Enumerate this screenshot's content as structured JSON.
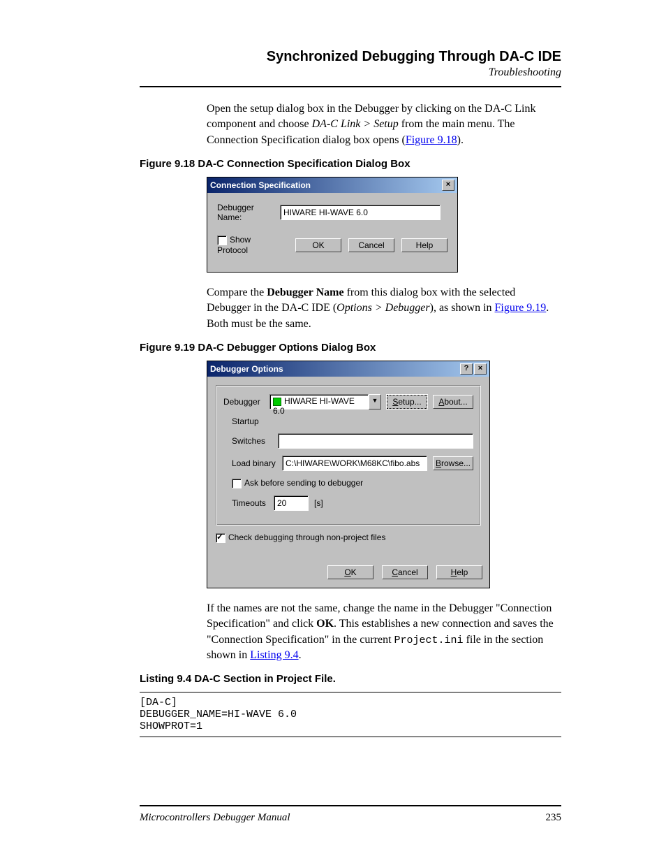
{
  "header": {
    "title": "Synchronized Debugging Through DA-C IDE",
    "sub": "Troubleshooting"
  },
  "p1": {
    "a": "Open the setup dialog box in the Debugger by clicking on the DA-C Link component and choose ",
    "b": "DA-C Link > Setup",
    "c": " from the main menu. The Connection Specification dialog box opens (",
    "link": "Figure 9.18",
    "d": ")."
  },
  "fig918": "Figure 9.18  DA-C Connection Specification Dialog Box",
  "dlg1": {
    "title": "Connection Specification",
    "debuggerNameLabel": "Debugger Name:",
    "debuggerName": "HIWARE HI-WAVE 6.0",
    "showProtocol": "Show Protocol",
    "ok": "OK",
    "cancel": "Cancel",
    "help": "Help"
  },
  "p2": {
    "a": "Compare the ",
    "b": "Debugger Name",
    "c": " from this dialog box with the selected Debugger in the DA-C IDE (",
    "d": "Options > Debugger",
    "e": "), as shown in ",
    "link": "Figure 9.19",
    "f": ". Both must be the same."
  },
  "fig919": "Figure 9.19  DA-C Debugger Options Dialog Box",
  "dlg2": {
    "title": "Debugger Options",
    "debuggerLabel": "Debugger",
    "debugger": "HIWARE HI-WAVE 6.0",
    "setup": "Setup...",
    "about": "About...",
    "startup": "Startup",
    "switches": "Switches",
    "switchesVal": "",
    "loadBinaryLabel": "Load binary",
    "loadBinary": "C:\\HIWARE\\WORK\\M68KC\\fibo.abs",
    "browse": "Browse...",
    "askBefore": "Ask before sending to debugger",
    "timeoutsLabel": "Timeouts",
    "timeouts": "20",
    "timeoutsUnit": "[s]",
    "checkDebug": "Check debugging through non-project files",
    "ok": "OK",
    "cancel": "Cancel",
    "help": "Help"
  },
  "p3": {
    "a": "If the names are not the same, change the name in the Debugger \"Connection Specification\" and click ",
    "b": "OK",
    "c": ". This establishes a new connection and saves the \"Connection Specification\" in the current ",
    "d": "Project.ini",
    "e": " file in the section shown in ",
    "link": "Listing 9.4",
    "f": "."
  },
  "listing": "Listing 9.4  DA-C Section in Project File.",
  "code": "[DA-C]\nDEBUGGER_NAME=HI-WAVE 6.0\nSHOWPROT=1",
  "footer": {
    "title": "Microcontrollers Debugger Manual",
    "page": "235"
  }
}
